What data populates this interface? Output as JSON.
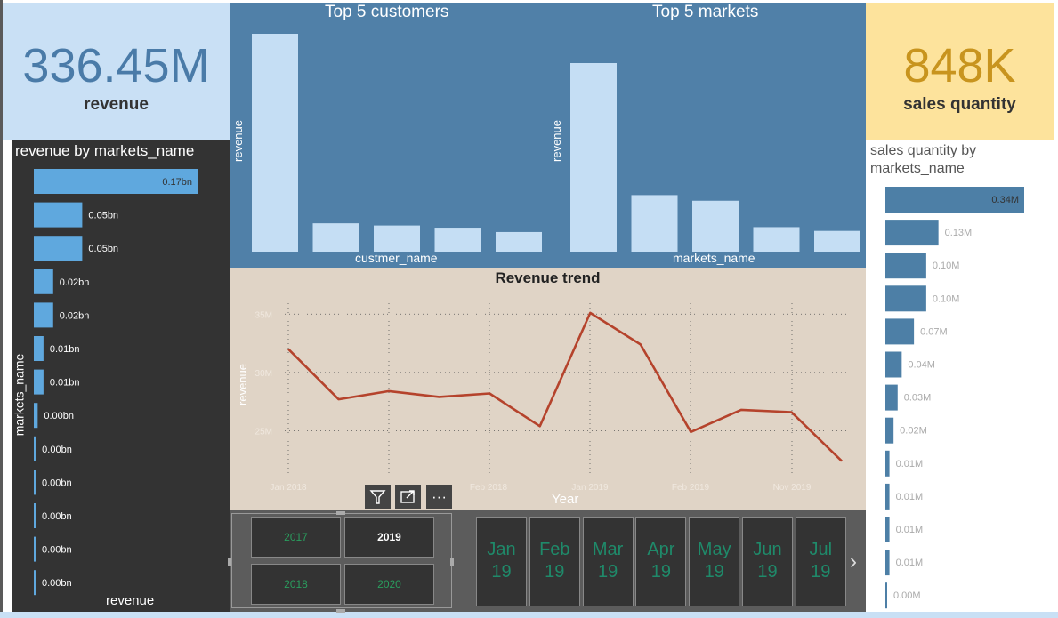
{
  "kpi": {
    "revenue_value": "336.45M",
    "revenue_label": "revenue",
    "sales_value": "848K",
    "sales_label": "sales quantity"
  },
  "colors": {
    "revenue_card_bg": "#c9e0f5",
    "revenue_value": "#4a7ba8",
    "sales_card_bg": "#fde39c",
    "sales_value": "#c8941e",
    "top_panel_bg": "#5080a8",
    "top_bar": "#c5def4",
    "left_bar": "#5fa8de",
    "right_bar": "#4d7fa6",
    "trend_line": "#b5432c",
    "trend_bg": "#e0d4c6",
    "year_text": "#2a9d5e",
    "month_text": "#1f8a6a"
  },
  "top_customers": {
    "title": "Top 5 customers",
    "xlabel": "custmer_name",
    "ylabel": "revenue"
  },
  "top_markets": {
    "title": "Top 5 markets",
    "xlabel": "markets_name",
    "ylabel": "revenue"
  },
  "revenue_by_market": {
    "title": "revenue by markets_name",
    "xlabel": "revenue",
    "ylabel": "markets_name"
  },
  "sales_by_market": {
    "title_line1": "sales quantity by",
    "title_line2": "markets_name"
  },
  "trend": {
    "title": "Revenue trend",
    "xlabel": "Year",
    "ylabel": "revenue",
    "y_ticks": [
      "35M",
      "30M",
      "25M"
    ],
    "x_ticks": [
      "Jan 2018",
      "Feb 2018",
      "Jan 2019",
      "Feb 2019",
      "Nov 2019"
    ]
  },
  "visual_header": {
    "filter_icon": "filter-icon",
    "focus_icon": "focus-mode-icon",
    "more_icon": "more-options-icon",
    "more_glyph": "···"
  },
  "year_slicer": {
    "years": [
      "2017",
      "2019",
      "2018",
      "2020"
    ],
    "selected": "2019"
  },
  "month_slicer": {
    "months": [
      {
        "m": "Jan",
        "y": "19"
      },
      {
        "m": "Feb",
        "y": "19"
      },
      {
        "m": "Mar",
        "y": "19"
      },
      {
        "m": "Apr",
        "y": "19"
      },
      {
        "m": "May",
        "y": "19"
      },
      {
        "m": "Jun",
        "y": "19"
      },
      {
        "m": "Jul",
        "y": "19"
      }
    ],
    "next_glyph": "›"
  },
  "chart_data": [
    {
      "id": "top_customers",
      "type": "bar",
      "title": "Top 5 customers",
      "xlabel": "custmer_name",
      "ylabel": "revenue",
      "categories": [
        "",
        "",
        "",
        "",
        ""
      ],
      "values": [
        100,
        13,
        12,
        11,
        9
      ],
      "ylim": [
        0,
        100
      ]
    },
    {
      "id": "top_markets",
      "type": "bar",
      "title": "Top 5 markets",
      "xlabel": "markets_name",
      "ylabel": "revenue",
      "categories": [
        "",
        "",
        "",
        "",
        ""
      ],
      "values": [
        100,
        30,
        27,
        13,
        11
      ],
      "ylim": [
        0,
        100
      ]
    },
    {
      "id": "revenue_by_market",
      "type": "bar",
      "orientation": "horizontal",
      "title": "revenue by markets_name",
      "xlabel": "revenue",
      "ylabel": "markets_name",
      "values": [
        0.17,
        0.05,
        0.05,
        0.02,
        0.02,
        0.01,
        0.01,
        0.004,
        0.002,
        0.001,
        0.001,
        0.001,
        0.001
      ],
      "labels": [
        "0.17bn",
        "0.05bn",
        "0.05bn",
        "0.02bn",
        "0.02bn",
        "0.01bn",
        "0.01bn",
        "0.00bn",
        "0.00bn",
        "0.00bn",
        "0.00bn",
        "0.00bn",
        "0.00bn"
      ]
    },
    {
      "id": "sales_by_market",
      "type": "bar",
      "orientation": "horizontal",
      "title": "sales quantity by markets_name",
      "values": [
        0.34,
        0.13,
        0.1,
        0.1,
        0.07,
        0.04,
        0.03,
        0.02,
        0.01,
        0.01,
        0.01,
        0.01,
        0.003
      ],
      "labels": [
        "0.34M",
        "0.13M",
        "0.10M",
        "0.10M",
        "0.07M",
        "0.04M",
        "0.03M",
        "0.02M",
        "0.01M",
        "0.01M",
        "0.01M",
        "0.01M",
        "0.00M"
      ]
    },
    {
      "id": "revenue_trend",
      "type": "line",
      "title": "Revenue trend",
      "xlabel": "Year",
      "ylabel": "revenue",
      "values": [
        32.0,
        27.7,
        28.4,
        27.9,
        28.2,
        25.4,
        35.1,
        32.4,
        24.9,
        26.8,
        26.6,
        22.4
      ],
      "ylim": [
        21,
        37
      ],
      "y_ticks": [
        35,
        30,
        25
      ],
      "grid": true
    }
  ]
}
